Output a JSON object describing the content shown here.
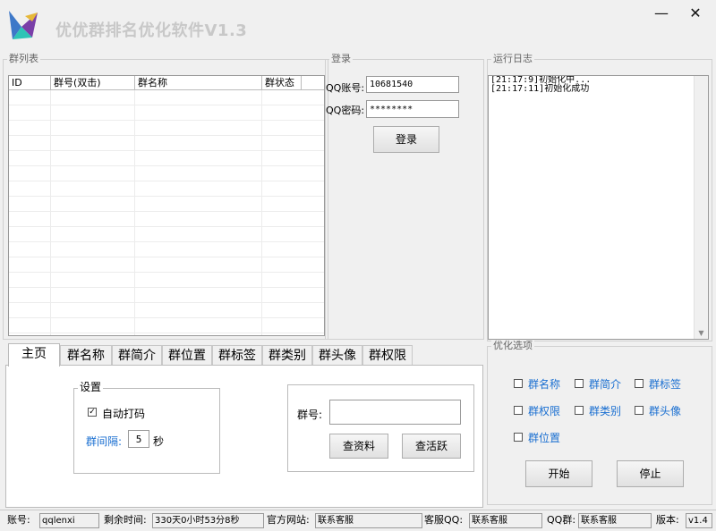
{
  "window": {
    "title": "优优群排名优化软件V1.3",
    "minimize_glyph": "—",
    "close_glyph": "✕"
  },
  "group_list": {
    "title": "群列表",
    "columns": [
      "ID",
      "群号(双击)",
      "群名称",
      "群状态"
    ]
  },
  "login": {
    "title": "登录",
    "qq_label": "QQ账号:",
    "qq_value": "10681540",
    "pwd_label": "QQ密码:",
    "pwd_value": "********",
    "login_button": "登录"
  },
  "log": {
    "title": "运行日志",
    "lines": [
      "[21:17:9]初始化中...",
      "[21:17:11]初始化成功"
    ]
  },
  "tabs": [
    "主页",
    "群名称",
    "群简介",
    "群位置",
    "群标签",
    "群类别",
    "群头像",
    "群权限"
  ],
  "settings": {
    "title": "设置",
    "auto_captcha_label": "自动打码",
    "auto_captcha_checked": true,
    "interval_label": "群间隔:",
    "interval_value": "5",
    "interval_unit": "秒"
  },
  "query": {
    "group_label": "群号:",
    "group_value": "",
    "lookup_button": "查资料",
    "activity_button": "查活跃"
  },
  "optimize": {
    "title": "优化选项",
    "options": [
      {
        "label": "群名称",
        "checked": false
      },
      {
        "label": "群简介",
        "checked": false
      },
      {
        "label": "群标签",
        "checked": false
      },
      {
        "label": "群权限",
        "checked": false
      },
      {
        "label": "群类别",
        "checked": false
      },
      {
        "label": "群头像",
        "checked": false
      },
      {
        "label": "群位置",
        "checked": false
      }
    ],
    "start_button": "开始",
    "stop_button": "停止"
  },
  "status": {
    "account_label": "账号:",
    "account_value": "qqlenxi",
    "remaining_label": "剩余时间:",
    "remaining_value": "330天0小时53分8秒",
    "site_label": "官方网站:",
    "site_value": "联系客服",
    "service_qq_label": "客服QQ:",
    "service_qq_value": "联系客服",
    "qq_group_label": "QQ群:",
    "qq_group_value": "联系客服",
    "version_label": "版本:",
    "version_value": "v1.4"
  },
  "colors": {
    "accent_blue": "#1a6fd1",
    "title_gray": "#c8c8c8"
  }
}
